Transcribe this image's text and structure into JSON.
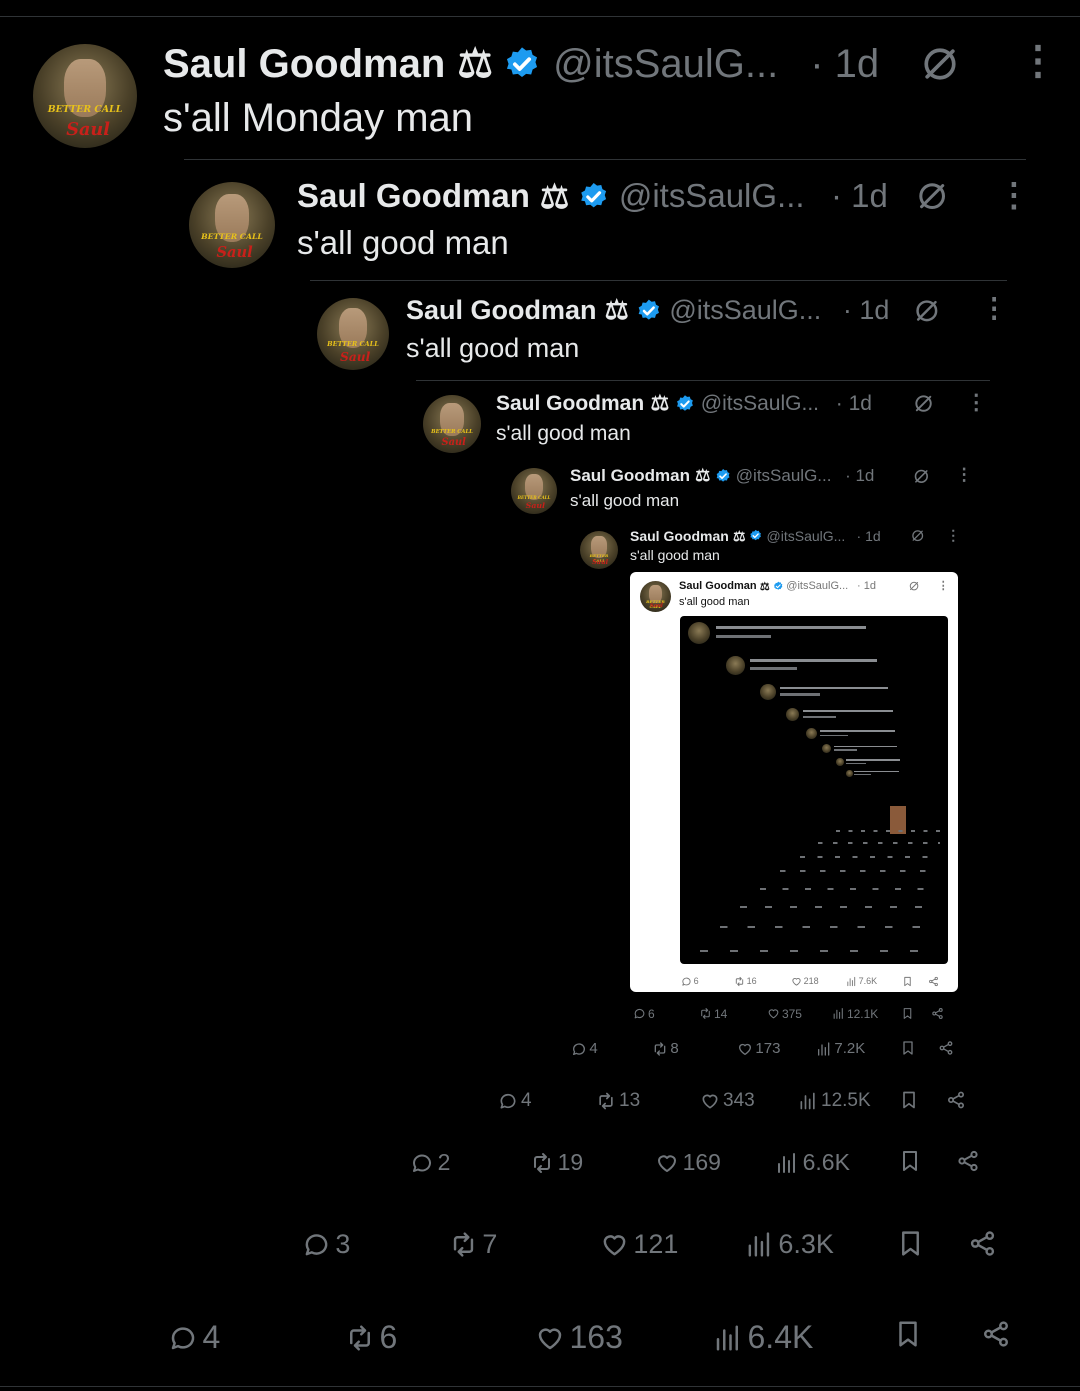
{
  "levels": [
    {
      "name": "Saul Goodman",
      "scales": "⚖",
      "handle": "@itsSaulG...",
      "time": "· 1d",
      "text": "s'all Monday man",
      "reply": "4",
      "repost": "6",
      "like": "163",
      "views": "6.4K"
    },
    {
      "name": "Saul Goodman",
      "scales": "⚖",
      "handle": "@itsSaulG...",
      "time": "· 1d",
      "text": "s'all good man",
      "reply": "3",
      "repost": "7",
      "like": "121",
      "views": "6.3K"
    },
    {
      "name": "Saul Goodman",
      "scales": "⚖",
      "handle": "@itsSaulG...",
      "time": "· 1d",
      "text": "s'all good man",
      "reply": "2",
      "repost": "19",
      "like": "169",
      "views": "6.6K"
    },
    {
      "name": "Saul Goodman",
      "scales": "⚖",
      "handle": "@itsSaulG...",
      "time": "· 1d",
      "text": "s'all good man",
      "reply": "4",
      "repost": "13",
      "like": "343",
      "views": "12.5K"
    },
    {
      "name": "Saul Goodman",
      "scales": "⚖",
      "handle": "@itsSaulG...",
      "time": "· 1d",
      "text": "s'all good man",
      "reply": "4",
      "repost": "8",
      "like": "173",
      "views": "7.2K"
    },
    {
      "name": "Saul Goodman",
      "scales": "⚖",
      "handle": "@itsSaulG...",
      "time": "· 1d",
      "text": "s'all good man",
      "reply": "6",
      "repost": "14",
      "like": "375",
      "views": "12.1K"
    },
    {
      "name": "Saul Goodman",
      "scales": "⚖",
      "handle": "@itsSaulG...",
      "time": "· 1d",
      "text": "s'all good man",
      "reply": "6",
      "repost": "16",
      "like": "218",
      "views": "7.6K"
    }
  ],
  "avatar_logo": {
    "top": "BETTER CALL",
    "bottom": "Saul"
  },
  "colors": {
    "bg": "#000000",
    "text": "#e7e9ea",
    "muted": "#71767b",
    "verified": "#1d9bf0",
    "divider": "#2f3336",
    "card": "#ffffff"
  },
  "icons": [
    "verified-badge-icon",
    "grok-icon",
    "more-icon",
    "reply-icon",
    "repost-icon",
    "like-icon",
    "views-icon",
    "bookmark-icon",
    "share-icon"
  ]
}
